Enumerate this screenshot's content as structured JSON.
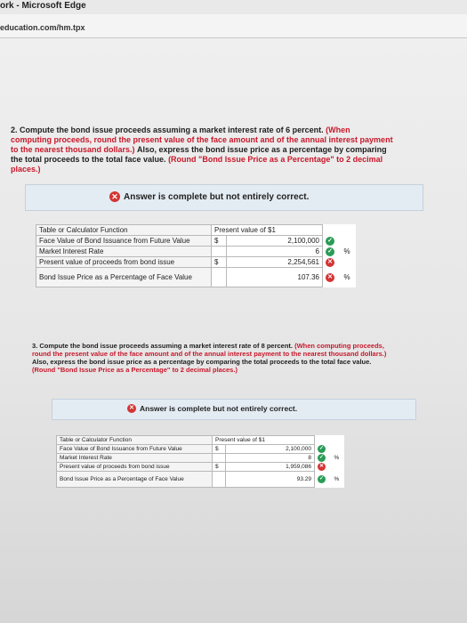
{
  "browser": {
    "title": "ork - Microsoft Edge",
    "url": "education.com/hm.tpx"
  },
  "question2": {
    "lead": "2. Compute the bond issue proceeds assuming a market interest rate of 6 percent.",
    "instruction1": "(When computing proceeds, round the present value of the face amount and of the annual interest payment to the nearest thousand dollars.)",
    "middle": "Also, express the bond issue price as a percentage by comparing the total proceeds to the total face value.",
    "instruction2": "(Round \"Bond Issue Price as a Percentage\" to 2 decimal places.)",
    "banner": "Answer is complete but not entirely correct.",
    "table": {
      "header_label": "Table or Calculator Function",
      "header_value": "Present value of $1",
      "rows": [
        {
          "label": "Face Value of Bond Issuance from Future Value",
          "currency": "$",
          "value": "2,100,000",
          "status": "correct",
          "unit": ""
        },
        {
          "label": "Market Interest Rate",
          "currency": "",
          "value": "6",
          "status": "correct",
          "unit": "%"
        },
        {
          "label": "Present value of proceeds from bond issue",
          "currency": "$",
          "value": "2,254,561",
          "status": "incorrect",
          "unit": ""
        },
        {
          "label": "Bond Issue Price as a Percentage of Face Value",
          "currency": "",
          "value": "107.36",
          "status": "incorrect",
          "unit": "%"
        }
      ]
    }
  },
  "question3": {
    "lead": "3. Compute the bond issue proceeds assuming a market interest rate of 8 percent.",
    "instruction1": "(When computing proceeds, round the present value of the face amount and of the annual interest payment to the nearest thousand dollars.)",
    "middle": "Also, express the bond issue price as a percentage by comparing the total proceeds to the total face value.",
    "instruction2": "(Round \"Bond Issue Price as a Percentage\" to 2 decimal places.)",
    "banner": "Answer is complete but not entirely correct.",
    "table": {
      "header_label": "Table or Calculator Function",
      "header_value": "Present value of $1",
      "rows": [
        {
          "label": "Face Value of Bond Issuance from Future Value",
          "currency": "$",
          "value": "2,100,000",
          "status": "correct",
          "unit": ""
        },
        {
          "label": "Market Interest Rate",
          "currency": "",
          "value": "8",
          "status": "correct",
          "unit": "%"
        },
        {
          "label": "Present value of proceeds from bond issue",
          "currency": "$",
          "value": "1,959,086",
          "status": "incorrect",
          "unit": ""
        },
        {
          "label": "Bond Issue Price as a Percentage of Face Value",
          "currency": "",
          "value": "93.29",
          "status": "correct",
          "unit": "%"
        }
      ]
    }
  },
  "colors": {
    "correct": "#2a9c55",
    "incorrect": "#d43434",
    "highlight": "#c8182a",
    "banner_bg": "#e4ecf3"
  },
  "icons": {
    "correct": "check-icon",
    "incorrect": "x-icon"
  }
}
